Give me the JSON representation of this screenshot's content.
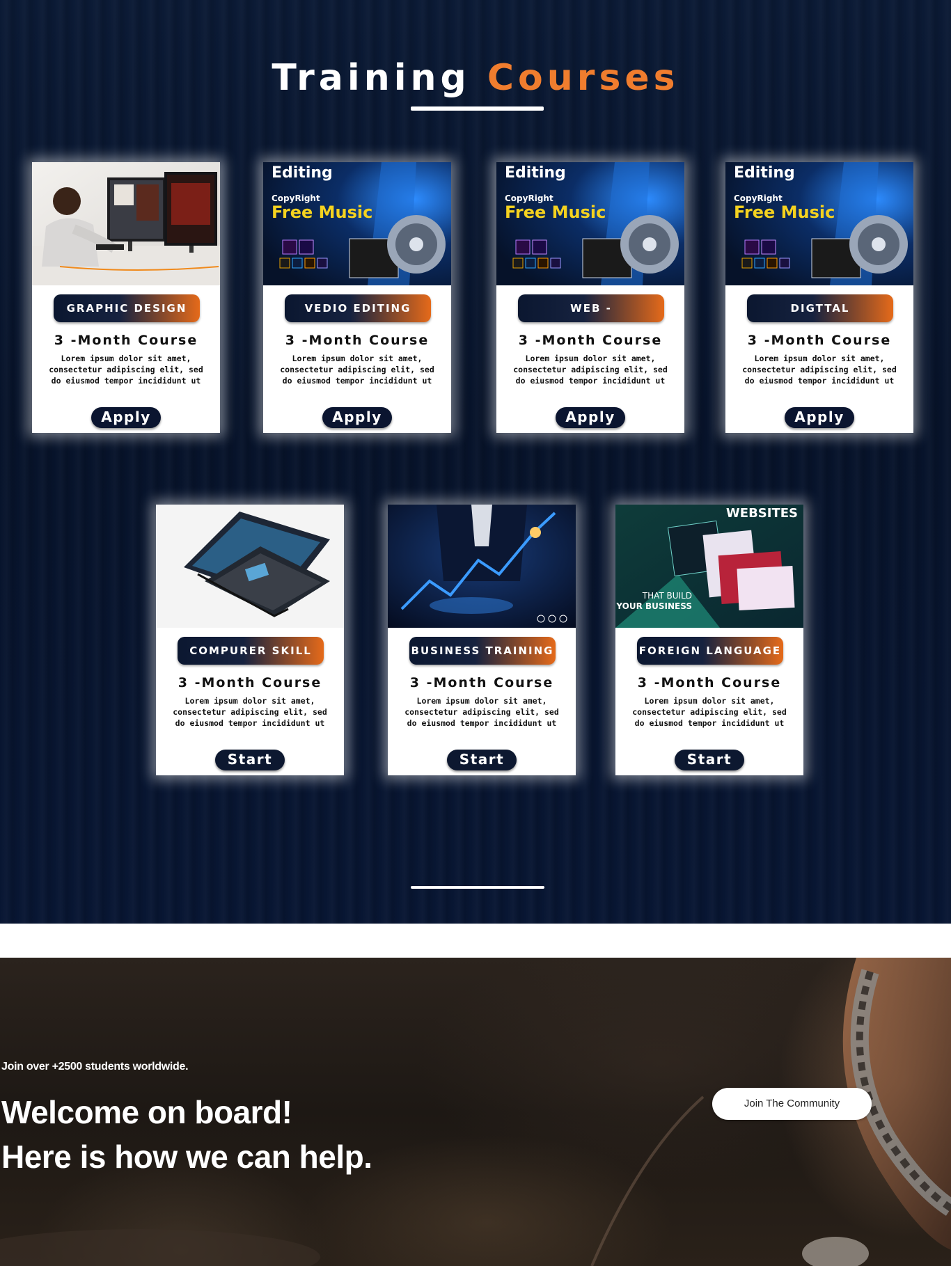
{
  "training": {
    "title_part1": "Training ",
    "title_part2": "Courses",
    "accent_color": "#f07d2e"
  },
  "courses": [
    {
      "badge": "GRAPHIC DESIGN",
      "duration": "3 -Month Course",
      "description": "Lorem ipsum dolor sit amet, consectetur adipiscing elit, sed do eiusmod tempor incididunt ut",
      "button": "Apply",
      "image": "graphic-design-photo"
    },
    {
      "badge": "VEDIO EDITING",
      "duration": "3 -Month Course",
      "description": "Lorem ipsum dolor sit amet, consectetur adipiscing elit, sed do eiusmod tempor incididunt ut",
      "button": "Apply",
      "image": "editing-banner",
      "image_text": {
        "line1": "Editing",
        "line2": "CopyRight",
        "line3": "Free Music"
      }
    },
    {
      "badge": "WEB - DEVELOPMENT",
      "duration": "3 -Month Course",
      "description": "Lorem ipsum dolor sit amet, consectetur adipiscing elit, sed do eiusmod tempor incididunt ut",
      "button": "Apply",
      "image": "editing-banner",
      "image_text": {
        "line1": "Editing",
        "line2": "CopyRight",
        "line3": "Free Music"
      }
    },
    {
      "badge": "DIGTTAL MARKETING",
      "duration": "3 -Month Course",
      "description": "Lorem ipsum dolor sit amet, consectetur adipiscing elit, sed do eiusmod tempor incididunt ut",
      "button": "Apply",
      "image": "editing-banner",
      "image_text": {
        "line1": "Editing",
        "line2": "CopyRight",
        "line3": "Free Music"
      }
    },
    {
      "badge": "COMPURER SKILL",
      "duration": "3 -Month Course",
      "description": "Lorem ipsum dolor sit amet, consectetur adipiscing elit, sed do eiusmod tempor incididunt ut",
      "button": "Start",
      "image": "laptop-exploded"
    },
    {
      "badge": "BUSINESS TRAINING",
      "duration": "3 -Month Course",
      "description": "Lorem ipsum dolor sit amet, consectetur adipiscing elit, sed do eiusmod tempor incididunt ut",
      "button": "Start",
      "image": "business-growth"
    },
    {
      "badge": "FOREIGN LANGUAGE",
      "duration": "3 -Month Course",
      "description": "Lorem ipsum dolor sit amet, consectetur adipiscing elit, sed do eiusmod tempor incididunt ut",
      "button": "Start",
      "image": "websites-banner",
      "image_text": {
        "line1": "WEBSITES",
        "line2": "THAT BUILD",
        "line3": "YOUR BUSINESS"
      }
    }
  ],
  "hero": {
    "kicker": "Join over +2500 students worldwide.",
    "heading_line1": "Welcome on board!",
    "heading_line2": "Here is how we can help.",
    "cta": "Join The Community"
  }
}
